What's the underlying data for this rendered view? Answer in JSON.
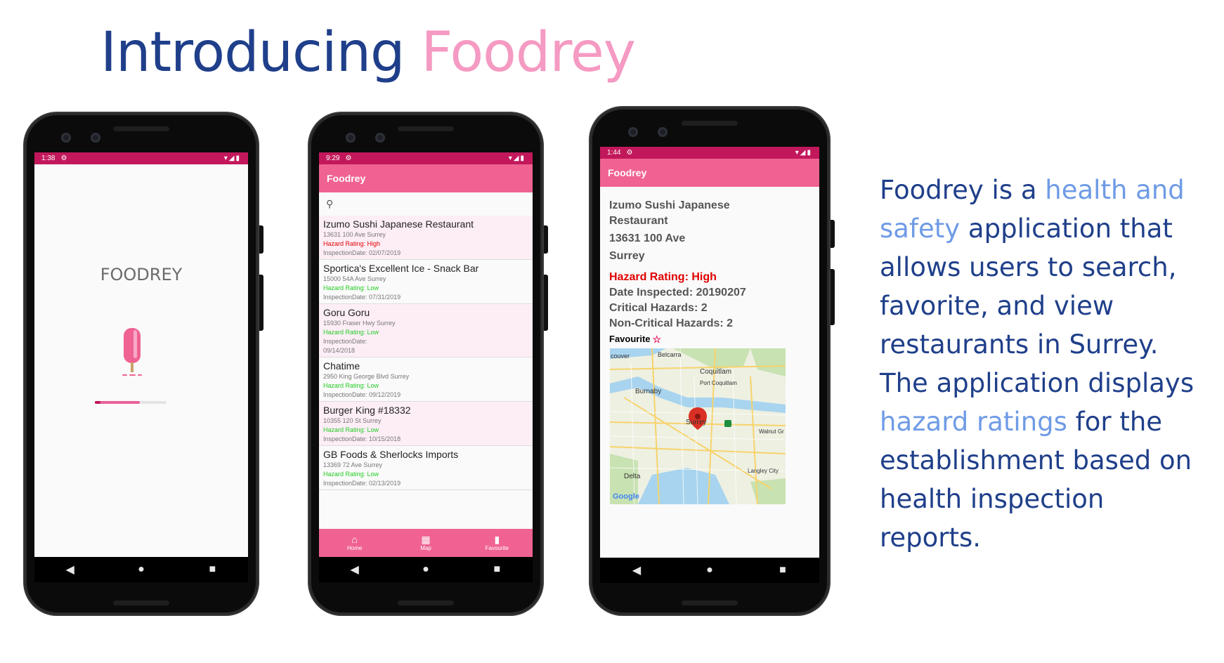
{
  "title": {
    "part1": "Introducing",
    "part2": "Foodrey"
  },
  "phone1": {
    "time": "1:38",
    "splash_text": "FOODREY"
  },
  "phone2": {
    "time": "9:29",
    "app_title": "Foodrey",
    "restaurants": [
      {
        "name": "Izumo Sushi Japanese Restaurant",
        "address": "13631 100 Ave Surrey",
        "hazard": "Hazard Rating: High",
        "level": "high",
        "date": "InspectionDate: 02/07/2019"
      },
      {
        "name": "Sportica's Excellent Ice - Snack Bar",
        "address": "15000 54A Ave Surrey",
        "hazard": "Hazard Rating: Low",
        "level": "low",
        "date": "InspectionDate: 07/31/2019"
      },
      {
        "name": "Goru Goru",
        "address": "15930 Fraser Hwy Surrey",
        "hazard": "Hazard Rating: Low",
        "level": "low",
        "date": "InspectionDate:",
        "date2": "09/14/2018"
      },
      {
        "name": "Chatime",
        "address": "2950 King George Blvd Surrey",
        "hazard": "Hazard Rating: Low",
        "level": "low",
        "date": "InspectionDate: 09/12/2019"
      },
      {
        "name": "Burger King #18332",
        "address": "10355 120 St Surrey",
        "hazard": "Hazard Rating: Low",
        "level": "low",
        "date": "InspectionDate: 10/15/2018"
      },
      {
        "name": "GB Foods & Sherlocks Imports",
        "address": "13369 72 Ave Surrey",
        "hazard": "Hazard Rating: Low",
        "level": "low",
        "date": "InspectionDate: 02/13/2019"
      }
    ],
    "tabs": {
      "home": "Home",
      "map": "Map",
      "favourite": "Favourite"
    }
  },
  "phone3": {
    "time": "1:44",
    "app_title": "Foodrey",
    "name_line1": "Izumo Sushi Japanese",
    "name_line2": "Restaurant",
    "address_line1": "13631 100 Ave",
    "address_line2": "Surrey",
    "hazard": "Hazard Rating: High",
    "date": "Date Inspected: 20190207",
    "critical": "Critical Hazards: 2",
    "noncritical": "Non-Critical Hazards: 2",
    "favourite": "Favourite",
    "map_labels": {
      "couver": "couver",
      "belcarra": "Belcarra",
      "coquitlam": "Coquitlam",
      "port_coquitlam": "Port Coquitlam",
      "burnaby": "Burnaby",
      "surrey": "Surrey",
      "walnut": "Walnut Gr",
      "delta": "Delta",
      "langley": "Langley City",
      "google": "Google"
    }
  },
  "description": {
    "p1": "Foodrey is a ",
    "h1": "health and safety",
    "p2": " application that allows users to search, favorite, and view restaurants in Surrey. The application displays ",
    "h2": "hazard ratings",
    "p3": " for the establishment based on health inspection reports."
  },
  "colors": {
    "title_blue": "#1f3f8a",
    "title_pink": "#f59ac2",
    "app_pink": "#f06292",
    "status_pink": "#c2185b"
  }
}
